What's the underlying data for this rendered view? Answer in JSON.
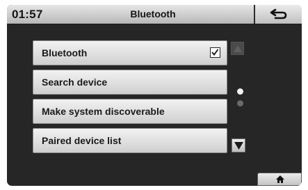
{
  "header": {
    "clock": "01:57",
    "title": "Bluetooth",
    "back_icon": "back-arrow-icon"
  },
  "menu": {
    "items": [
      {
        "label": "Bluetooth",
        "checked": true
      },
      {
        "label": "Search device"
      },
      {
        "label": "Make system discoverable"
      },
      {
        "label": "Paired device list"
      }
    ]
  },
  "scroll": {
    "up_icon": "triangle-up-icon",
    "down_icon": "triangle-down-icon",
    "page_count": 2,
    "current_page": 1
  },
  "footer": {
    "home_icon": "home-icon"
  },
  "colors": {
    "screen_bg": "#262626",
    "button_light": "#f2f2f2",
    "button_dark": "#cfcfcf",
    "text": "#1a1a1a"
  }
}
